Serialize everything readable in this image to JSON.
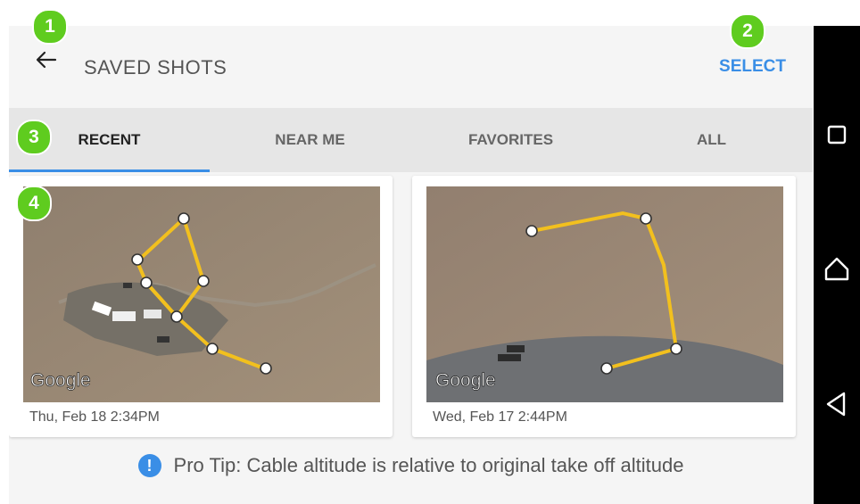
{
  "header": {
    "title": "SAVED SHOTS",
    "select_label": "SELECT",
    "back_icon": "arrow-left-icon"
  },
  "tabs": [
    {
      "label": "RECENT",
      "active": true
    },
    {
      "label": "NEAR ME",
      "active": false
    },
    {
      "label": "FAVORITES",
      "active": false
    },
    {
      "label": "ALL",
      "active": false
    }
  ],
  "shots": [
    {
      "date": "Thu, Feb 18 2:34PM",
      "map_attribution": "Google"
    },
    {
      "date": "Wed, Feb 17 2:44PM",
      "map_attribution": "Google"
    }
  ],
  "pro_tip": {
    "icon": "exclamation-icon",
    "icon_glyph": "!",
    "text": "Pro Tip: Cable altitude is relative to original take off altitude"
  },
  "annotations": [
    "1",
    "2",
    "3",
    "4"
  ],
  "system_nav": [
    "recent-apps-icon",
    "home-icon",
    "back-icon"
  ],
  "colors": {
    "accent": "#3a8ee6",
    "path": "#f2c01e",
    "badge": "#5fcc1f"
  }
}
